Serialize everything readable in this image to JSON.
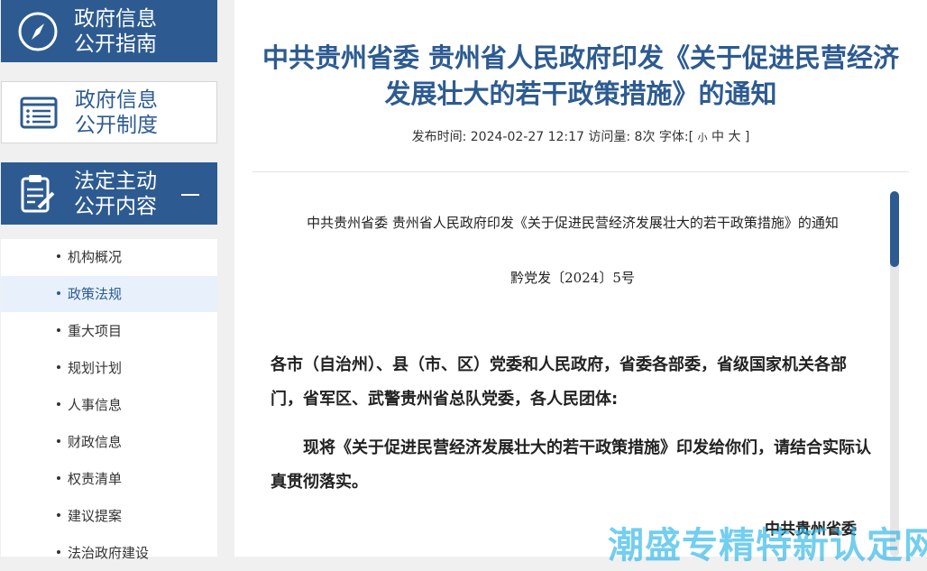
{
  "sidebar": {
    "guide_label": "政府信息\n公开指南",
    "system_label": "政府信息\n公开制度",
    "statutory_label": "法定主动\n公开内容",
    "items": [
      {
        "label": "机构概况"
      },
      {
        "label": "政策法规",
        "active": true
      },
      {
        "label": "重大项目"
      },
      {
        "label": "规划计划"
      },
      {
        "label": "人事信息"
      },
      {
        "label": "财政信息"
      },
      {
        "label": "权责清单"
      },
      {
        "label": "建议提案"
      },
      {
        "label": "法治政府建设"
      }
    ]
  },
  "article": {
    "title": "中共贵州省委 贵州省人民政府印发《关于促进民营经济发展壮大的若干政策措施》的通知",
    "meta_prefix": "发布时间: 2024-02-27 12:17 访问量: 8次 字体:[",
    "font_small": "小",
    "font_medium": "中",
    "font_large": "大",
    "meta_suffix": "]",
    "doc_heading": "中共贵州省委 贵州省人民政府印发《关于促进民营经济发展壮大的若干政策措施》的通知",
    "doc_number": "黔党发〔2024〕5号",
    "para1": "各市（自治州）、县（市、区）党委和人民政府，省委各部委，省级国家机关各部门，省军区、武警贵州省总队党委，各人民团体:",
    "para2": "现将《关于促进民营经济发展壮大的若干政策措施》印发给你们，请结合实际认真贯彻落实。",
    "sign": "中共贵州省委"
  },
  "watermark": "潮盛专精特新认定网",
  "colors": {
    "brand": "#2d5b91",
    "active_bg": "#e8f1fb"
  }
}
